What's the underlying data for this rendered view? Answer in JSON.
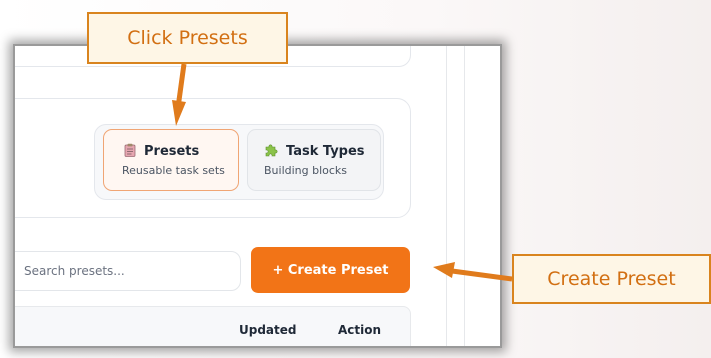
{
  "nav": {
    "presets": {
      "title": "Presets",
      "subtitle": "Reusable task sets",
      "icon": "clipboard-icon"
    },
    "task_types": {
      "title": "Task Types",
      "subtitle": "Building blocks",
      "icon": "puzzle-icon"
    }
  },
  "search": {
    "placeholder": "Search presets..."
  },
  "create_button": {
    "label": "+ Create Preset"
  },
  "table": {
    "headers": [
      "Updated",
      "Action"
    ]
  },
  "annotations": {
    "click_presets": "Click Presets",
    "create_preset": "Create Preset"
  },
  "colors": {
    "accent": "#f27417",
    "callout_border": "#d9841e",
    "callout_fill": "#fef6e6",
    "callout_text": "#d26f12"
  }
}
